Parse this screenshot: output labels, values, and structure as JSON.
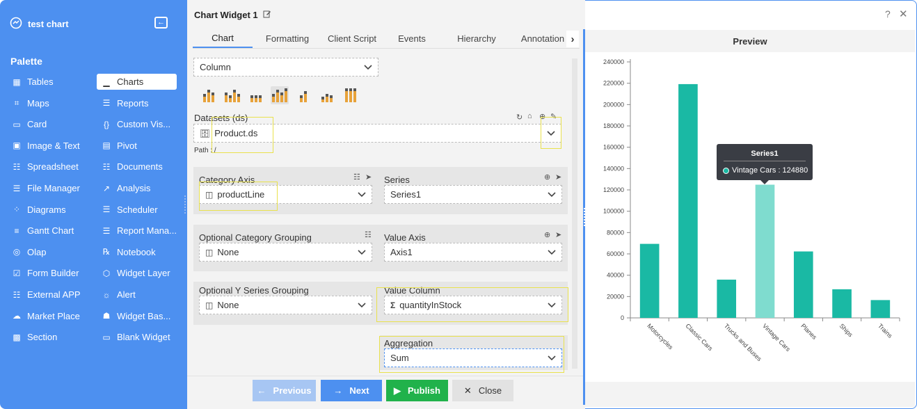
{
  "app": {
    "title": "test chart"
  },
  "palette": {
    "title": "Palette",
    "left": [
      {
        "label": "Tables",
        "icon": "table-icon"
      },
      {
        "label": "Maps",
        "icon": "map-icon"
      },
      {
        "label": "Card",
        "icon": "card-icon"
      },
      {
        "label": "Image & Text",
        "icon": "image-icon"
      },
      {
        "label": "Spreadsheet",
        "icon": "spreadsheet-icon"
      },
      {
        "label": "File Manager",
        "icon": "folder-icon"
      },
      {
        "label": "Diagrams",
        "icon": "diagram-icon"
      },
      {
        "label": "Gantt Chart",
        "icon": "gantt-icon"
      },
      {
        "label": "Olap",
        "icon": "olap-icon"
      },
      {
        "label": "Form Builder",
        "icon": "form-icon"
      },
      {
        "label": "External APP",
        "icon": "grid-icon"
      },
      {
        "label": "Market Place",
        "icon": "cloud-icon"
      },
      {
        "label": "Section",
        "icon": "section-icon"
      }
    ],
    "right": [
      {
        "label": "Charts",
        "icon": "chart-icon"
      },
      {
        "label": "Reports",
        "icon": "report-icon"
      },
      {
        "label": "Custom Vis...",
        "icon": "braces-icon"
      },
      {
        "label": "Pivot",
        "icon": "pivot-icon"
      },
      {
        "label": "Documents",
        "icon": "document-icon"
      },
      {
        "label": "Analysis",
        "icon": "analysis-icon"
      },
      {
        "label": "Scheduler",
        "icon": "scheduler-icon"
      },
      {
        "label": "Report Mana...",
        "icon": "report-manager-icon"
      },
      {
        "label": "Notebook",
        "icon": "notebook-icon"
      },
      {
        "label": "Widget Layer",
        "icon": "layers-icon"
      },
      {
        "label": "Alert",
        "icon": "alert-icon"
      },
      {
        "label": "Widget Bas...",
        "icon": "basket-icon"
      },
      {
        "label": "Blank Widget",
        "icon": "blank-widget-icon"
      }
    ]
  },
  "widget": {
    "title": "Chart Widget 1",
    "tabs": [
      "Chart",
      "Formatting",
      "Client Script",
      "Events",
      "Hierarchy",
      "Annotation"
    ],
    "chart_type_value": "Column",
    "datasets_label": "Datasets (ds)",
    "dataset_value": "Product.ds",
    "path_text": "Path : /",
    "category_axis_label": "Category Axis",
    "category_axis_value": "productLine",
    "series_label": "Series",
    "series_value": "Series1",
    "optional_category_grouping_label": "Optional Category Grouping",
    "optional_category_grouping_value": "None",
    "value_axis_label": "Value Axis",
    "value_axis_value": "Axis1",
    "optional_y_series_grouping_label": "Optional Y Series Grouping",
    "optional_y_series_grouping_value": "None",
    "value_column_label": "Value Column",
    "value_column_value": "quantityInStock",
    "aggregation_label": "Aggregation",
    "aggregation_value": "Sum"
  },
  "footer": {
    "previous": "Previous",
    "next": "Next",
    "publish": "Publish",
    "close": "Close"
  },
  "preview": {
    "title": "Preview",
    "tooltip": {
      "title": "Series1",
      "text": "Vintage Cars : 124880"
    }
  },
  "colors": {
    "sidebar": "#4d90f0",
    "bar": "#1ab9a4",
    "bar_highlight": "#7fdccf",
    "publish": "#21b24b",
    "next": "#4d90f0",
    "previous": "#a7c6f3"
  },
  "chart_data": {
    "type": "bar",
    "categories": [
      "Motorcycles",
      "Classic Cars",
      "Trucks and Buses",
      "Vintage Cars",
      "Planes",
      "Ships",
      "Trains"
    ],
    "series": [
      {
        "name": "Series1",
        "values": [
          69401,
          219183,
          35851,
          124880,
          62287,
          26833,
          16696
        ]
      }
    ],
    "ylim": [
      0,
      240000
    ],
    "yticks": [
      0,
      20000,
      40000,
      60000,
      80000,
      100000,
      120000,
      140000,
      160000,
      180000,
      200000,
      220000,
      240000
    ],
    "highlighted_category": "Vintage Cars",
    "grid": false
  }
}
